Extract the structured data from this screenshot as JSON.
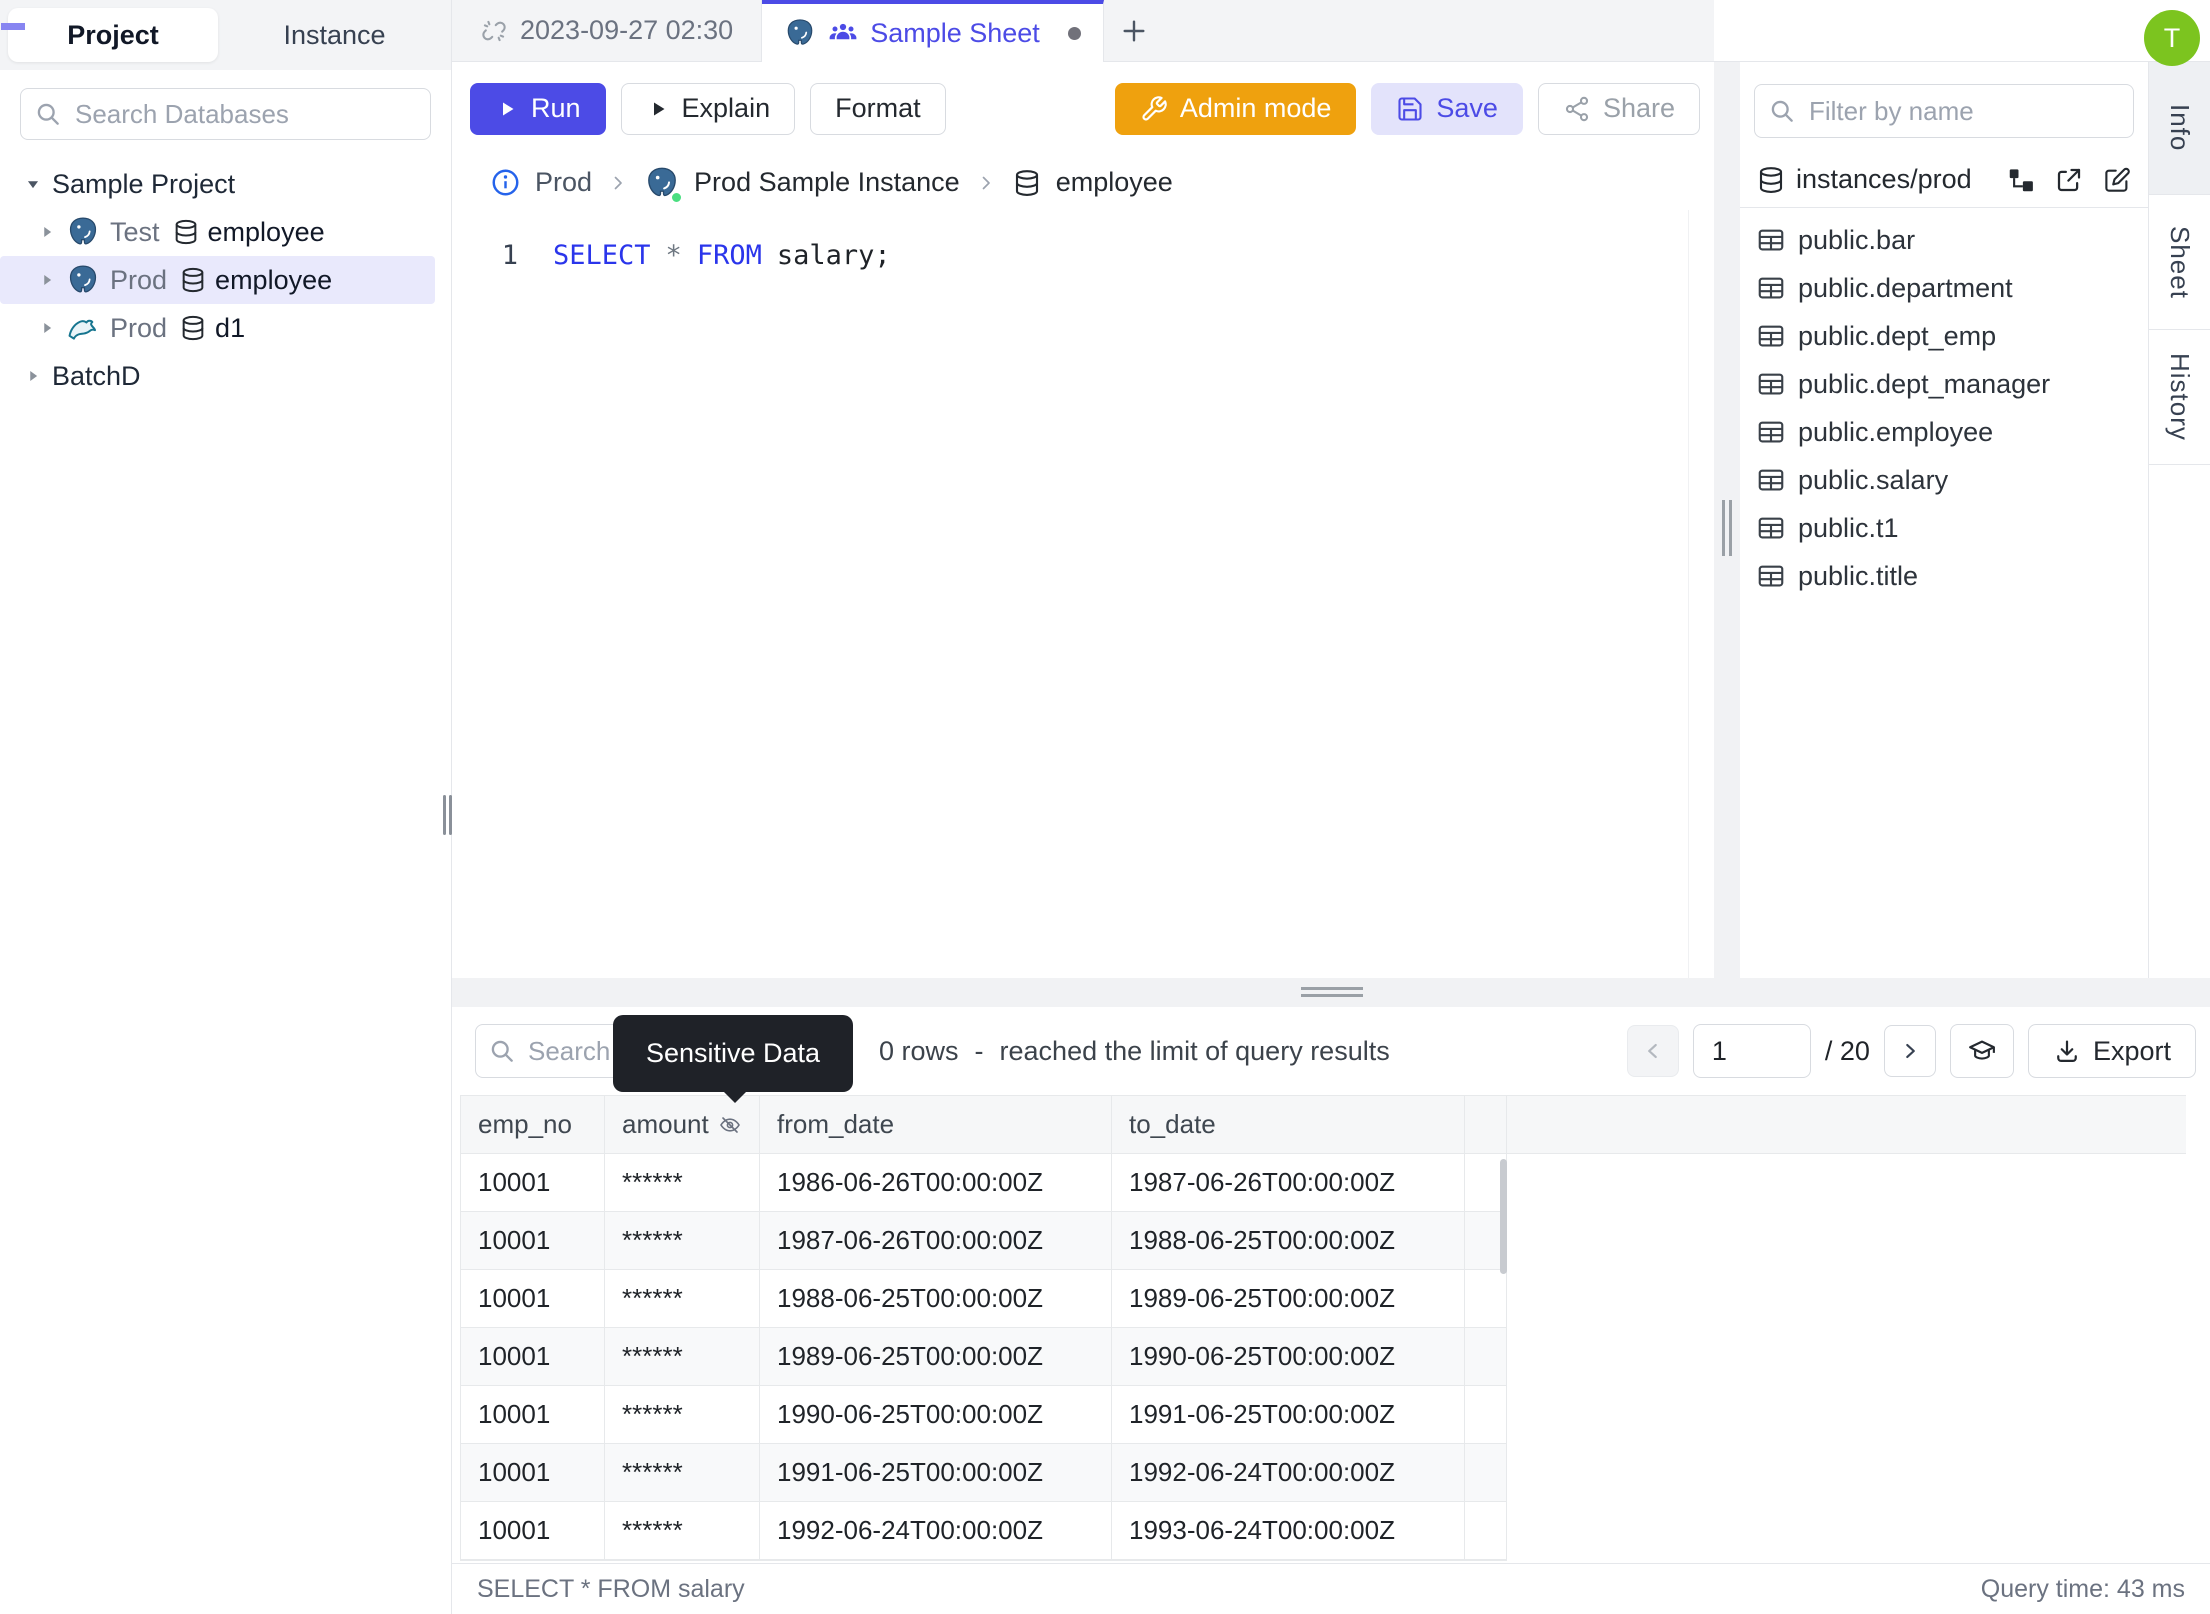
{
  "header": {
    "avatar": "T"
  },
  "sidebar": {
    "tabs": [
      {
        "label": "Project",
        "active": true
      },
      {
        "label": "Instance",
        "active": false
      }
    ],
    "search_placeholder": "Search Databases",
    "tree": [
      {
        "label": "Sample Project",
        "expanded": true
      },
      {
        "env": "Test",
        "database": "employee",
        "engine": "postgresql",
        "selected": false
      },
      {
        "env": "Prod",
        "database": "employee",
        "engine": "postgresql",
        "selected": true
      },
      {
        "env": "Prod",
        "database": "d1",
        "engine": "mysql",
        "selected": false
      },
      {
        "label": "BatchD",
        "expanded": false
      }
    ]
  },
  "tabs_bar": {
    "tabs": [
      {
        "label": "2023-09-27 02:30",
        "icon": "unlink",
        "active": false
      },
      {
        "label": "Sample Sheet",
        "icons": [
          "postgresql",
          "people-group"
        ],
        "active": true,
        "unsaved": true
      }
    ],
    "add_label": "+"
  },
  "toolbar": {
    "run": "Run",
    "explain": "Explain",
    "format": "Format",
    "admin_mode": "Admin mode",
    "save": "Save",
    "share": "Share"
  },
  "breadcrumb": {
    "environment": "Prod",
    "instance": "Prod Sample Instance",
    "database": "employee"
  },
  "editor": {
    "line_number": "1",
    "code": {
      "kw1": "SELECT",
      "star": "*",
      "kw2": "FROM",
      "rest": "salary;"
    }
  },
  "right_panel": {
    "filter_placeholder": "Filter by name",
    "scope": "instances/prod",
    "tables": [
      "public.bar",
      "public.department",
      "public.dept_emp",
      "public.dept_manager",
      "public.employee",
      "public.salary",
      "public.t1",
      "public.title"
    ]
  },
  "side_tabs": [
    "Info",
    "Sheet",
    "History"
  ],
  "results": {
    "search_placeholder": "Search",
    "tooltip": "Sensitive Data",
    "rows_label": "0 rows",
    "dash": "-",
    "limit_notice": "reached the limit of query results",
    "pagination": {
      "current": "1",
      "total": "/ 20"
    },
    "export_label": "Export",
    "table": {
      "columns": [
        "emp_no",
        "amount",
        "from_date",
        "to_date"
      ],
      "masked_column": "amount",
      "rows": [
        [
          "10001",
          "******",
          "1986-06-26T00:00:00Z",
          "1987-06-26T00:00:00Z"
        ],
        [
          "10001",
          "******",
          "1987-06-26T00:00:00Z",
          "1988-06-25T00:00:00Z"
        ],
        [
          "10001",
          "******",
          "1988-06-25T00:00:00Z",
          "1989-06-25T00:00:00Z"
        ],
        [
          "10001",
          "******",
          "1989-06-25T00:00:00Z",
          "1990-06-25T00:00:00Z"
        ],
        [
          "10001",
          "******",
          "1990-06-25T00:00:00Z",
          "1991-06-25T00:00:00Z"
        ],
        [
          "10001",
          "******",
          "1991-06-25T00:00:00Z",
          "1992-06-24T00:00:00Z"
        ],
        [
          "10001",
          "******",
          "1992-06-24T00:00:00Z",
          "1993-06-24T00:00:00Z"
        ]
      ]
    },
    "status_query": "SELECT * FROM salary",
    "query_time": "Query time: 43 ms"
  },
  "icons": {
    "search": "magnifier",
    "unlink": "broken-chain",
    "postgresql": "blue-elephant",
    "mysql": "teal-dolphin",
    "database": "cylinder",
    "table": "grid-rows",
    "people-group": "three-persons",
    "play": "triangle-right",
    "wrench": "wrench",
    "save": "floppy-disk",
    "share": "connected-nodes",
    "info": "circled-i",
    "schema-diagram": "linked-squares",
    "external-link": "box-arrow-out",
    "edit": "square-pencil",
    "eye-off": "crossed-eye",
    "export": "download-tray",
    "learn": "graduation-cap",
    "chevron": "angle-bracket"
  },
  "colors": {
    "accent": "#4c4be6",
    "admin_mode": "#efa10e",
    "avatar": "#7cc41f",
    "selected_row": "#e9e9fc",
    "keyword": "#2a35eb",
    "tooltip_bg": "#1f2228",
    "status_dot": "#4ade80"
  }
}
